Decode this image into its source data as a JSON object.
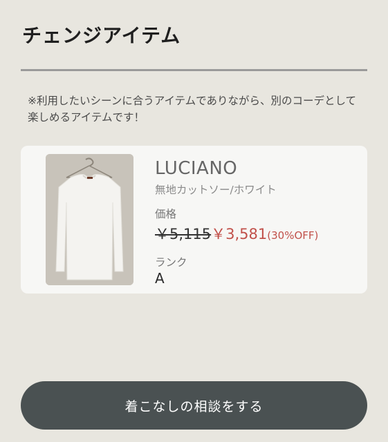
{
  "header": {
    "title": "チェンジアイテム"
  },
  "note": "※利用したいシーンに合うアイテムでありながら、別のコーデとして楽しめるアイテムです！",
  "product": {
    "brand": "LUCIANO",
    "name": "無地カットソー/ホワイト",
    "price_label": "価格",
    "original_price": "￥5,115",
    "sale_price": "￥3,581",
    "discount": "(30%OFF)",
    "rank_label": "ランク",
    "rank_value": "A"
  },
  "cta": {
    "label": "着こなしの相談をする"
  },
  "colors": {
    "background": "#e8e6df",
    "card": "#f7f7f5",
    "sale": "#c1504a",
    "button": "#4a5152"
  }
}
